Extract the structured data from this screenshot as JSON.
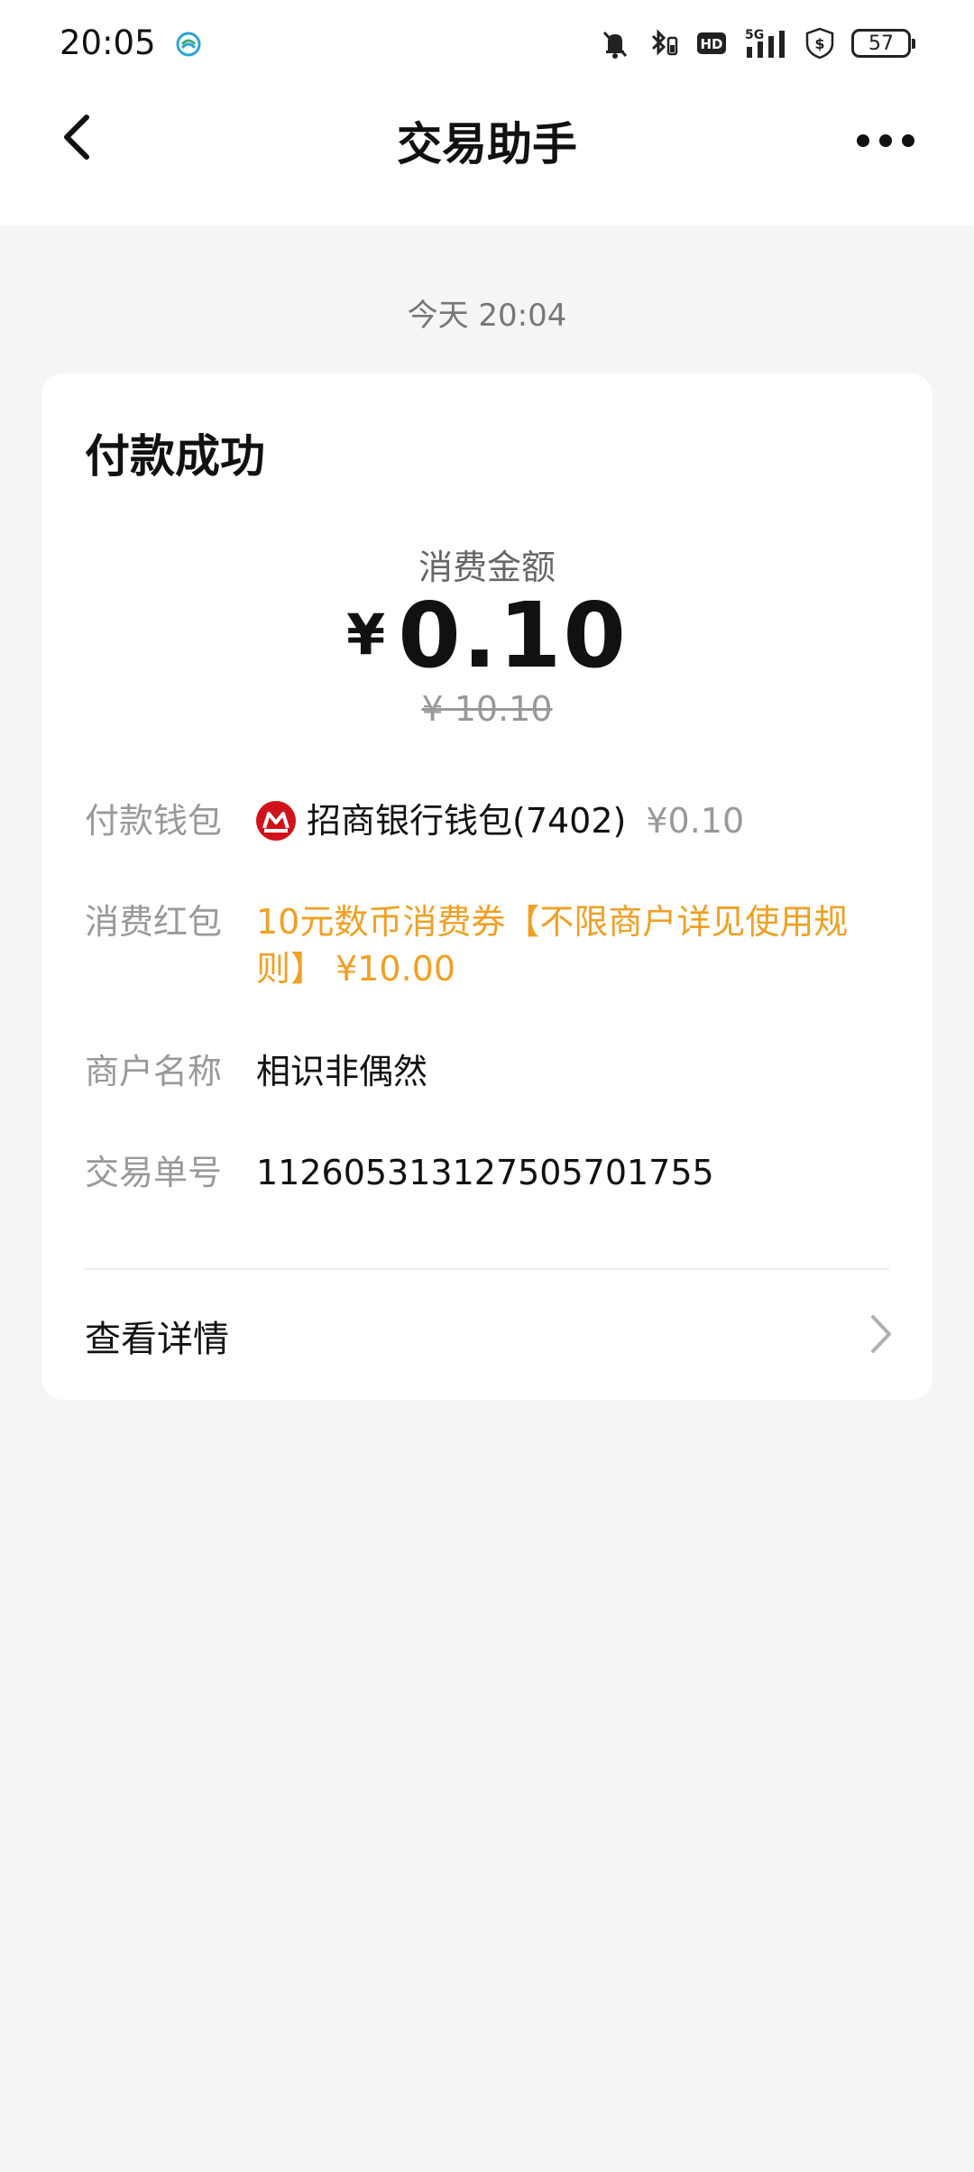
{
  "status_bar": {
    "time": "20:05",
    "network": "5G",
    "hd": "HD",
    "battery": "57"
  },
  "nav": {
    "title": "交易助手"
  },
  "message": {
    "timestamp": "今天 20:04"
  },
  "card": {
    "title": "付款成功",
    "amount_label": "消费金额",
    "currency_symbol": "¥",
    "amount": "0.10",
    "original_amount": "¥ 10.10",
    "rows": [
      {
        "label": "付款钱包",
        "value": "招商银行钱包(7402)",
        "extra": "¥0.10"
      },
      {
        "label": "消费红包",
        "value": "10元数币消费券【不限商户详见使用规则】 ¥10.00"
      },
      {
        "label": "商户名称",
        "value": "相识非偶然"
      },
      {
        "label": "交易单号",
        "value": "112605313127505701755"
      }
    ],
    "detail_link": "查看详情"
  },
  "colors": {
    "accent_orange": "#f0a023",
    "bank_red": "#d0121b",
    "background": "#f4f5f7"
  },
  "icons": {
    "back": "chevron-left-icon",
    "more": "more-dots-icon",
    "detail": "chevron-right-icon",
    "bank": "cmb-bank-logo"
  }
}
